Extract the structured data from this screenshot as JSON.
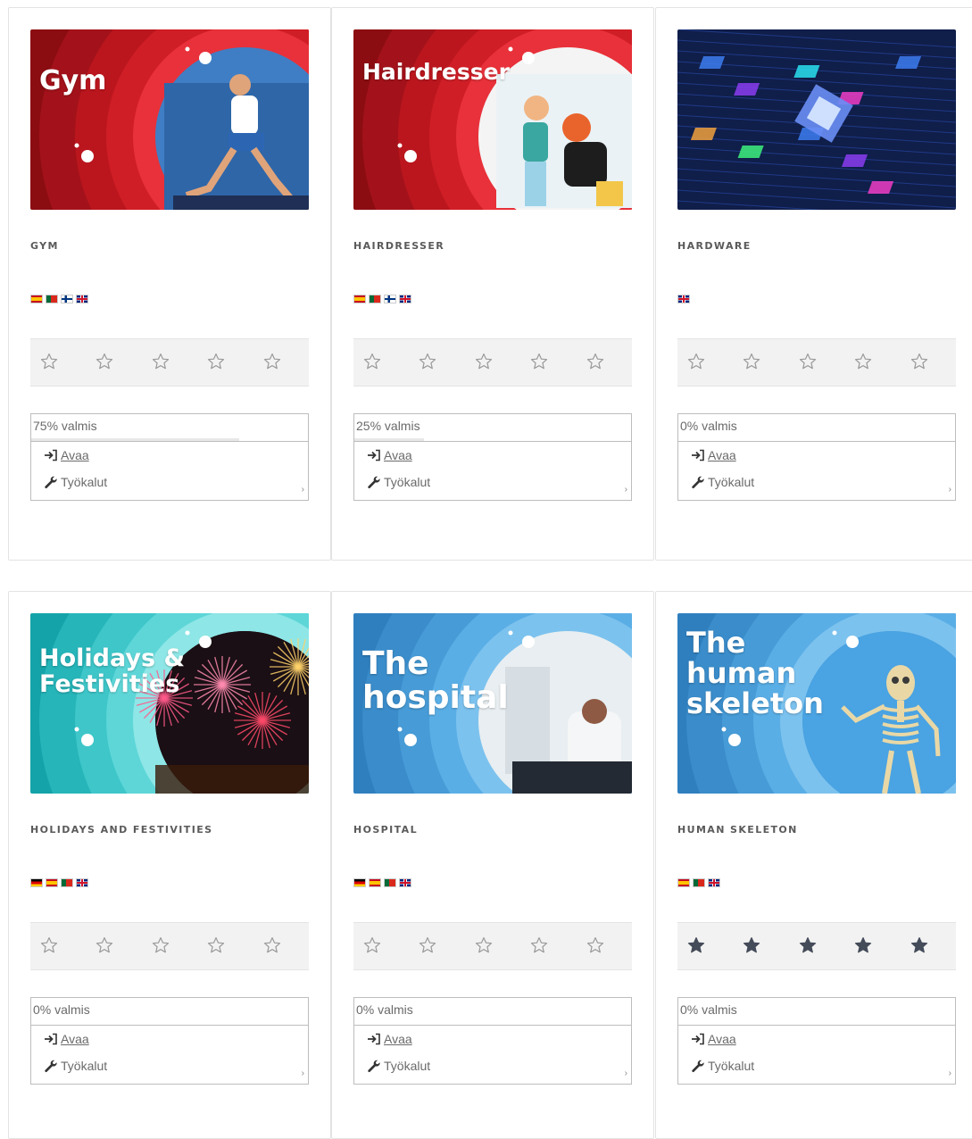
{
  "cards": [
    {
      "name": "GYM",
      "thumb_title": "Gym",
      "thumb_theme": "red",
      "flags": [
        "es",
        "pt",
        "fi",
        "gb"
      ],
      "rating": 0,
      "progress_label": "75% valmis",
      "progress_value": 75,
      "open_label": "Avaa",
      "tools_label": "Työkalut"
    },
    {
      "name": "HAIRDRESSER",
      "thumb_title": "Hairdresser",
      "thumb_theme": "red",
      "flags": [
        "es",
        "pt",
        "fi",
        "gb"
      ],
      "rating": 0,
      "progress_label": "25% valmis",
      "progress_value": 25,
      "open_label": "Avaa",
      "tools_label": "Työkalut"
    },
    {
      "name": "HARDWARE",
      "thumb_title": "",
      "thumb_theme": "circuit",
      "flags": [
        "gb"
      ],
      "rating": 0,
      "progress_label": "0% valmis",
      "progress_value": 0,
      "open_label": "Avaa",
      "tools_label": "Työkalut"
    },
    {
      "name": "HOLIDAYS AND FESTIVITIES",
      "thumb_title": "Holidays &\nFestivities",
      "thumb_theme": "teal",
      "flags": [
        "de",
        "es",
        "pt",
        "gb"
      ],
      "rating": 0,
      "progress_label": "0% valmis",
      "progress_value": 0,
      "open_label": "Avaa",
      "tools_label": "Työkalut"
    },
    {
      "name": "HOSPITAL",
      "thumb_title": "The\nhospital",
      "thumb_theme": "blue",
      "flags": [
        "de",
        "es",
        "pt",
        "gb"
      ],
      "rating": 0,
      "progress_label": "0% valmis",
      "progress_value": 0,
      "open_label": "Avaa",
      "tools_label": "Työkalut"
    },
    {
      "name": "HUMAN SKELETON",
      "thumb_title": "The\nhuman\nskeleton",
      "thumb_theme": "blue",
      "flags": [
        "es",
        "pt",
        "gb"
      ],
      "rating": 5,
      "progress_label": "0% valmis",
      "progress_value": 0,
      "open_label": "Avaa",
      "tools_label": "Työkalut"
    }
  ],
  "colors": {
    "red_dark": "#8b0d12",
    "red_mid": "#c8161d",
    "red_light": "#e8313a",
    "teal_dark": "#14a3a8",
    "teal_light": "#5ed6d8",
    "blue_dark": "#2f7fbf",
    "blue_light": "#5aaee6",
    "star_outline": "#999999",
    "star_filled": "#444b59"
  },
  "icons": {
    "open": "sign-in-icon",
    "tools": "wrench-icon",
    "star": "star-icon"
  }
}
